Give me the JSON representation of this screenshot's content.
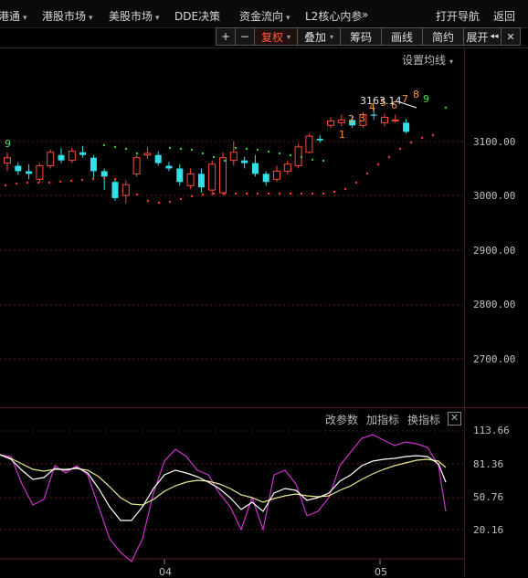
{
  "menu": [
    {
      "label": "港通",
      "caret": true
    },
    {
      "label": "港股市场",
      "caret": true
    },
    {
      "label": "美股市场",
      "caret": true
    },
    {
      "label": "DDE决策",
      "caret": false
    },
    {
      "label": "资金流向",
      "caret": true
    },
    {
      "label": "L2核心内参",
      "caret": false
    },
    {
      "label": "»",
      "caret": false
    },
    {
      "label": "打开导航",
      "caret": false
    },
    {
      "label": "返回",
      "caret": false
    }
  ],
  "toolbar": {
    "plus": "+",
    "minus": "−",
    "fuquan": "复权",
    "diejia": "叠加",
    "chouma": "筹码",
    "huaxian": "画线",
    "jianyue": "简约",
    "zhankai": "展开",
    "zhankai_arrows": "◂◂",
    "close": "✕"
  },
  "settings_avg": "设置均线",
  "price_label": "3163.14",
  "y_axis_labels": [
    "3100.00",
    "3000.00",
    "2900.00",
    "2800.00",
    "2700.00"
  ],
  "indicator": {
    "change_params": "改参数",
    "add_indicator": "加指标",
    "switch_indicator": "换指标",
    "close": "✕",
    "y_labels": [
      "113.66",
      "81.36",
      "50.76",
      "20.16"
    ]
  },
  "x_axis_labels": [
    "04",
    "05"
  ],
  "td_labels": {
    "left_nine": "9",
    "seq": [
      "1",
      "2",
      "3",
      "4",
      "5",
      "6",
      "7",
      "8",
      "9"
    ]
  },
  "colors": {
    "up": "#ff4a3a",
    "down": "#33e0e8",
    "td_orange": "#ff9a33",
    "td_green": "#55dd55",
    "kdj_k": "#ffffff",
    "kdj_d": "#e8e890",
    "kdj_j": "#cc33cc",
    "dot_up": "#ff3333",
    "dot_down": "#33cc33"
  },
  "chart_data": {
    "type": "candlestick",
    "ylim": [
      2650,
      3200
    ],
    "candles": [
      {
        "o": 3060,
        "c": 3070,
        "h": 3080,
        "l": 3045
      },
      {
        "o": 3055,
        "c": 3045,
        "h": 3062,
        "l": 3038
      },
      {
        "o": 3045,
        "c": 3040,
        "h": 3058,
        "l": 3030
      },
      {
        "o": 3030,
        "c": 3055,
        "h": 3060,
        "l": 3025
      },
      {
        "o": 3055,
        "c": 3080,
        "h": 3085,
        "l": 3050
      },
      {
        "o": 3075,
        "c": 3065,
        "h": 3088,
        "l": 3060
      },
      {
        "o": 3065,
        "c": 3082,
        "h": 3088,
        "l": 3060
      },
      {
        "o": 3080,
        "c": 3075,
        "h": 3092,
        "l": 3070
      },
      {
        "o": 3070,
        "c": 3045,
        "h": 3075,
        "l": 3030
      },
      {
        "o": 3045,
        "c": 3035,
        "h": 3050,
        "l": 3010
      },
      {
        "o": 3025,
        "c": 2995,
        "h": 3030,
        "l": 2990
      },
      {
        "o": 3000,
        "c": 3020,
        "h": 3028,
        "l": 2985
      },
      {
        "o": 3040,
        "c": 3070,
        "h": 3075,
        "l": 3035
      },
      {
        "o": 3075,
        "c": 3078,
        "h": 3090,
        "l": 3068
      },
      {
        "o": 3075,
        "c": 3060,
        "h": 3082,
        "l": 3055
      },
      {
        "o": 3055,
        "c": 3050,
        "h": 3062,
        "l": 3045
      },
      {
        "o": 3050,
        "c": 3025,
        "h": 3058,
        "l": 3018
      },
      {
        "o": 3018,
        "c": 3040,
        "h": 3050,
        "l": 3012
      },
      {
        "o": 3040,
        "c": 3015,
        "h": 3050,
        "l": 3005
      },
      {
        "o": 3010,
        "c": 3058,
        "h": 3065,
        "l": 3000
      },
      {
        "o": 3005,
        "c": 3070,
        "h": 3080,
        "l": 3000
      },
      {
        "o": 3065,
        "c": 3080,
        "h": 3100,
        "l": 3055
      },
      {
        "o": 3065,
        "c": 3060,
        "h": 3072,
        "l": 3050
      },
      {
        "o": 3060,
        "c": 3040,
        "h": 3075,
        "l": 3035
      },
      {
        "o": 3040,
        "c": 3025,
        "h": 3045,
        "l": 3018
      },
      {
        "o": 3030,
        "c": 3045,
        "h": 3055,
        "l": 3025
      },
      {
        "o": 3045,
        "c": 3058,
        "h": 3065,
        "l": 3040
      },
      {
        "o": 3055,
        "c": 3090,
        "h": 3095,
        "l": 3050
      },
      {
        "o": 3080,
        "c": 3110,
        "h": 3115,
        "l": 3078
      },
      {
        "o": 3105,
        "c": 3102,
        "h": 3112,
        "l": 3098
      },
      {
        "o": 3130,
        "c": 3138,
        "h": 3145,
        "l": 3125
      },
      {
        "o": 3135,
        "c": 3140,
        "h": 3150,
        "l": 3128
      },
      {
        "o": 3140,
        "c": 3130,
        "h": 3148,
        "l": 3125
      },
      {
        "o": 3130,
        "c": 3150,
        "h": 3155,
        "l": 3125
      },
      {
        "o": 3150,
        "c": 3148,
        "h": 3163,
        "l": 3140
      },
      {
        "o": 3135,
        "c": 3145,
        "h": 3152,
        "l": 3128
      },
      {
        "o": 3140,
        "c": 3140,
        "h": 3150,
        "l": 3135
      },
      {
        "o": 3135,
        "c": 3118,
        "h": 3142,
        "l": 3115
      }
    ]
  }
}
